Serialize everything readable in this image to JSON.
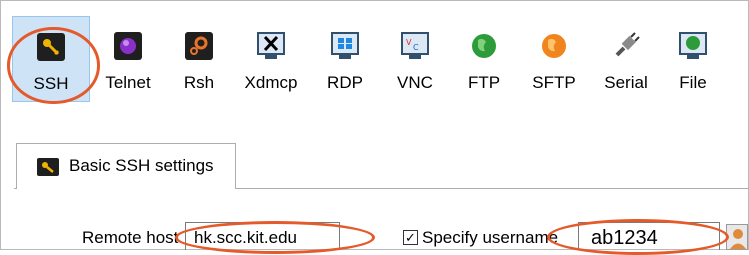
{
  "toolbar": {
    "tools": [
      {
        "label": "SSH",
        "icon": "ssh-key-icon",
        "selected": true
      },
      {
        "label": "Telnet",
        "icon": "telnet-icon",
        "selected": false
      },
      {
        "label": "Rsh",
        "icon": "rsh-gears-icon",
        "selected": false
      },
      {
        "label": "Xdmcp",
        "icon": "xdmcp-x-icon",
        "selected": false
      },
      {
        "label": "RDP",
        "icon": "rdp-windows-icon",
        "selected": false
      },
      {
        "label": "VNC",
        "icon": "vnc-icon",
        "selected": false
      },
      {
        "label": "FTP",
        "icon": "ftp-globe-icon",
        "selected": false
      },
      {
        "label": "SFTP",
        "icon": "sftp-globe-icon",
        "selected": false
      },
      {
        "label": "Serial",
        "icon": "serial-plug-icon",
        "selected": false
      },
      {
        "label": "File",
        "icon": "file-globe-icon",
        "selected": false
      }
    ]
  },
  "settings_tab": {
    "label": "Basic SSH settings",
    "icon": "ssh-key-icon"
  },
  "form": {
    "remote_host_label": "Remote host",
    "remote_host_value": "hk.scc.kit.edu",
    "specify_username_label": "Specify username",
    "specify_username_checked": true,
    "username_value": "ab1234"
  },
  "colors": {
    "selection": "#cfe3f7",
    "annotation": "#e45a2a",
    "ssh_icon_bg": "#1f1f1f",
    "ssh_key": "#f0b400"
  }
}
